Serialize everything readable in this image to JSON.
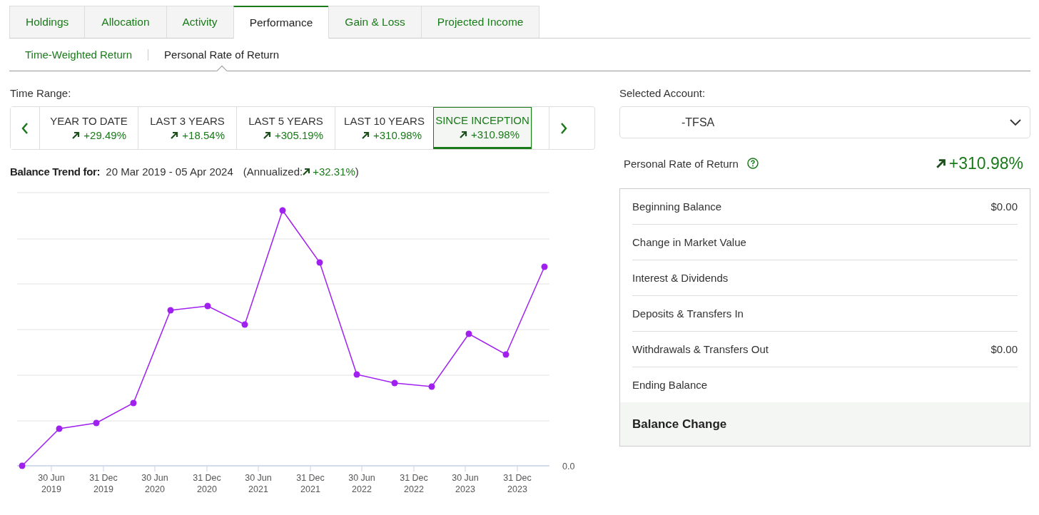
{
  "tabs": [
    {
      "label": "Holdings",
      "selected": false
    },
    {
      "label": "Allocation",
      "selected": false
    },
    {
      "label": "Activity",
      "selected": false
    },
    {
      "label": "Performance",
      "selected": true
    },
    {
      "label": "Gain & Loss",
      "selected": false
    },
    {
      "label": "Projected Income",
      "selected": false
    }
  ],
  "subtabs": [
    {
      "label": "Time-Weighted Return",
      "selected": false
    },
    {
      "label": "Personal Rate of Return",
      "selected": true
    }
  ],
  "time_range": {
    "label": "Time Range:",
    "ranges": [
      {
        "label": "YEAR TO DATE",
        "change": "+29.49%",
        "selected": false
      },
      {
        "label": "LAST 3 YEARS",
        "change": "+18.54%",
        "selected": false
      },
      {
        "label": "LAST 5 YEARS",
        "change": "+305.19%",
        "selected": false
      },
      {
        "label": "LAST 10 YEARS",
        "change": "+310.98%",
        "selected": false
      },
      {
        "label": "SINCE INCEPTION",
        "change": "+310.98%",
        "selected": true
      }
    ]
  },
  "balance_trend": {
    "label": "Balance Trend for:",
    "period": "20 Mar 2019 - 05 Apr 2024",
    "annualized_label": "(Annualized:",
    "annualized_value": "+32.31%",
    "annualized_close": ")",
    "y_label": "0.0",
    "x_labels": [
      {
        "date": "30 Jun",
        "year": "2019"
      },
      {
        "date": "31 Dec",
        "year": "2019"
      },
      {
        "date": "30 Jun",
        "year": "2020"
      },
      {
        "date": "31 Dec",
        "year": "2020"
      },
      {
        "date": "30 Jun",
        "year": "2021"
      },
      {
        "date": "31 Dec",
        "year": "2021"
      },
      {
        "date": "30 Jun",
        "year": "2022"
      },
      {
        "date": "31 Dec",
        "year": "2022"
      },
      {
        "date": "30 Jun",
        "year": "2023"
      },
      {
        "date": "31 Dec",
        "year": "2023"
      }
    ]
  },
  "account": {
    "label": "Selected Account:",
    "value": "-TFSA"
  },
  "personal_rate": {
    "label": "Personal Rate of Return",
    "value": "+310.98%"
  },
  "summary": [
    {
      "label": "Beginning Balance",
      "value": "$0.00",
      "kind": "row"
    },
    {
      "label": "Change in Market Value",
      "kind": "row"
    },
    {
      "label": "Interest & Dividends",
      "kind": "row"
    },
    {
      "label": "Deposits & Transfers In",
      "kind": "row"
    },
    {
      "label": "Withdrawals & Transfers Out",
      "value": "$0.00",
      "kind": "row"
    },
    {
      "label": "Ending Balance",
      "kind": "row"
    },
    {
      "label": "Balance Change",
      "kind": "total"
    }
  ]
}
